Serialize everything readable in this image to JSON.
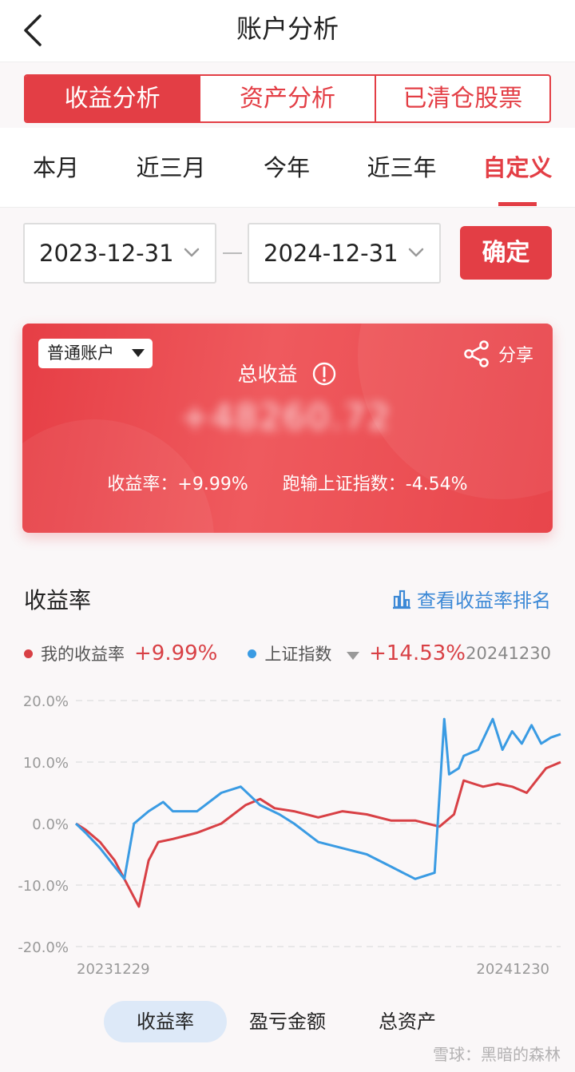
{
  "header": {
    "title": "账户分析"
  },
  "segments": [
    {
      "label": "收益分析",
      "active": true
    },
    {
      "label": "资产分析",
      "active": false
    },
    {
      "label": "已清仓股票",
      "active": false
    }
  ],
  "range_tabs": [
    {
      "label": "本月",
      "active": false
    },
    {
      "label": "近三月",
      "active": false
    },
    {
      "label": "今年",
      "active": false
    },
    {
      "label": "近三年",
      "active": false
    },
    {
      "label": "自定义",
      "active": true
    }
  ],
  "date_range": {
    "start": "2023-12-31",
    "end": "2024-12-31",
    "confirm_label": "确定"
  },
  "card": {
    "account_select": "普通账户",
    "share_label": "分享",
    "total_label": "总收益",
    "total_value": "+48260.72",
    "return_rate_text": "收益率：+9.99%",
    "vs_index_text": "跑输上证指数：-4.54%"
  },
  "section": {
    "title": "收益率",
    "rank_link": "查看收益率排名"
  },
  "legend": {
    "mine_label": "我的收益率",
    "mine_value": "+9.99%",
    "index_label": "上证指数",
    "index_value": "+14.53%",
    "date": "20241230"
  },
  "colors": {
    "accent": "#e33e45",
    "mine": "#d84045",
    "index": "#3a9be3"
  },
  "bottom_tabs": [
    {
      "label": "收益率",
      "active": true
    },
    {
      "label": "盈亏金额",
      "active": false
    },
    {
      "label": "总资产",
      "active": false
    }
  ],
  "watermark": "雪球：黑暗的森林",
  "chart_data": {
    "type": "line",
    "y_ticks": [
      "20.0%",
      "10.0%",
      "0.0%",
      "-10.0%",
      "-20.0%"
    ],
    "x_tick_labels": [
      "20231229",
      "20241230"
    ],
    "ylim": [
      -20,
      20
    ],
    "grid": true,
    "series": [
      {
        "name": "我的收益率",
        "x": [
          0,
          0.02,
          0.05,
          0.08,
          0.1,
          0.13,
          0.15,
          0.17,
          0.2,
          0.25,
          0.3,
          0.35,
          0.38,
          0.41,
          0.45,
          0.5,
          0.55,
          0.6,
          0.65,
          0.7,
          0.75,
          0.78,
          0.8,
          0.82,
          0.84,
          0.87,
          0.9,
          0.93,
          0.95,
          0.97,
          1.0
        ],
        "values": [
          0,
          -1,
          -3,
          -6,
          -9,
          -13.5,
          -6,
          -3,
          -2.5,
          -1.5,
          0,
          3,
          4,
          2.5,
          2,
          1,
          2,
          1.5,
          0.5,
          0.5,
          -0.5,
          1.5,
          7,
          6.5,
          6,
          6.5,
          6,
          5,
          7,
          9,
          9.99
        ]
      },
      {
        "name": "上证指数",
        "x": [
          0,
          0.02,
          0.05,
          0.08,
          0.1,
          0.12,
          0.15,
          0.18,
          0.2,
          0.25,
          0.3,
          0.34,
          0.38,
          0.42,
          0.45,
          0.5,
          0.55,
          0.6,
          0.65,
          0.7,
          0.74,
          0.76,
          0.77,
          0.79,
          0.8,
          0.83,
          0.86,
          0.88,
          0.9,
          0.92,
          0.94,
          0.96,
          0.98,
          1.0
        ],
        "values": [
          0,
          -1.5,
          -4,
          -7,
          -9,
          0,
          2,
          3.5,
          2,
          2,
          5,
          6,
          3,
          1.5,
          0,
          -3,
          -4,
          -5,
          -7,
          -9,
          -8,
          17,
          8,
          9,
          11,
          12,
          17,
          12,
          15,
          13,
          16,
          13,
          14,
          14.53
        ]
      }
    ]
  }
}
